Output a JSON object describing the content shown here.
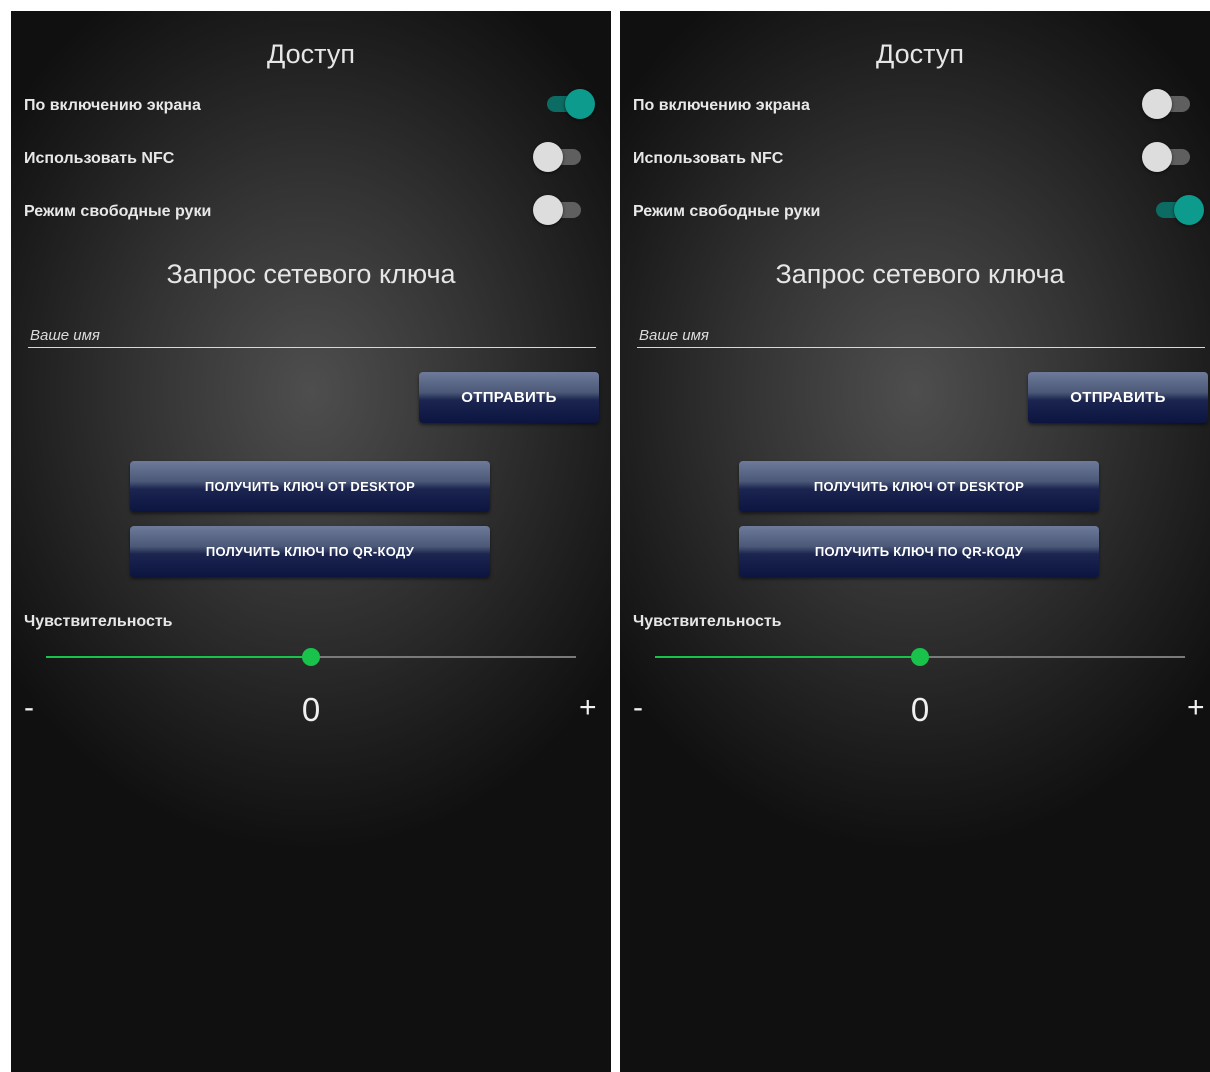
{
  "screens": [
    {
      "title": "Доступ",
      "settings": [
        {
          "label": "По включению экрана",
          "enabled": true
        },
        {
          "label": "Использовать NFC",
          "enabled": false
        },
        {
          "label": "Режим свободные руки",
          "enabled": false
        }
      ],
      "key_request_title": "Запрос сетевого ключа",
      "name_placeholder": "Ваше имя",
      "send_button": "ОТПРАВИТЬ",
      "desktop_button": "ПОЛУЧИТЬ КЛЮЧ ОТ DESKTOP",
      "qr_button": "ПОЛУЧИТЬ КЛЮЧ ПО QR-КОДУ",
      "sensitivity_label": "Чувствительность",
      "sensitivity_level": 0.5,
      "minus_label": "-",
      "plus_label": "+",
      "sensitivity_value": "0"
    },
    {
      "title": "Доступ",
      "settings": [
        {
          "label": "По включению экрана",
          "enabled": false
        },
        {
          "label": "Использовать NFC",
          "enabled": false
        },
        {
          "label": "Режим свободные руки",
          "enabled": true
        }
      ],
      "key_request_title": "Запрос сетевого ключа",
      "name_placeholder": "Ваше имя",
      "send_button": "ОТПРАВИТЬ",
      "desktop_button": "ПОЛУЧИТЬ КЛЮЧ ОТ DESKTOP",
      "qr_button": "ПОЛУЧИТЬ КЛЮЧ ПО QR-КОДУ",
      "sensitivity_label": "Чувствительность",
      "sensitivity_level": 0.5,
      "minus_label": "-",
      "plus_label": "+",
      "sensitivity_value": "0"
    }
  ],
  "colors": {
    "toggle_on": "#0c9b8c",
    "toggle_off": "#dddddd",
    "slider_accent": "#19c24a",
    "button_dark": "#0c1440"
  }
}
